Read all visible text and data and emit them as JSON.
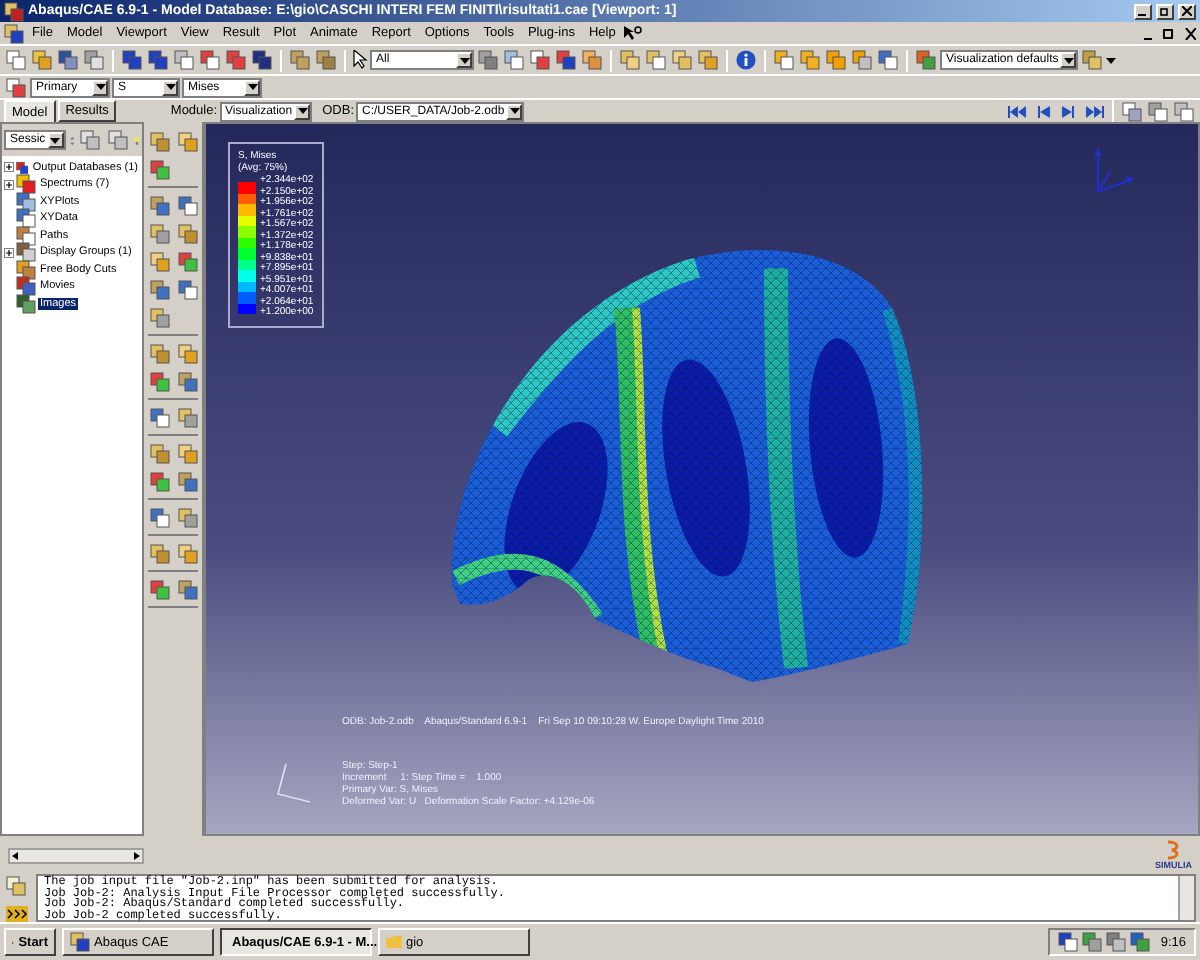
{
  "window": {
    "title": "Abaqus/CAE 6.9-1 - Model Database: E:\\gio\\CASCHI INTERI FEM FINITI\\risultati1.cae [Viewport: 1]"
  },
  "menu": [
    "File",
    "Model",
    "Viewport",
    "View",
    "Result",
    "Plot",
    "Animate",
    "Report",
    "Options",
    "Tools",
    "Plug-ins",
    "Help"
  ],
  "toolbar": {
    "selection_filter": "All",
    "view_defaults": "Visualization defaults"
  },
  "field_output": {
    "step": "Primary",
    "variable": "S",
    "invariant": "Mises"
  },
  "tabs": [
    {
      "label": "Model",
      "selected": true
    },
    {
      "label": "Results",
      "selected": false
    }
  ],
  "context": {
    "module_label": "Module:",
    "module": "Visualization",
    "odb_label": "ODB:",
    "odb": "C:/USER_DATA/Job-2.odb"
  },
  "tree": {
    "filter": "Sessic",
    "items": [
      {
        "label": "Output Databases (1)",
        "collapsible": true,
        "selected": false
      },
      {
        "label": "Spectrums (7)",
        "collapsible": true,
        "selected": false
      },
      {
        "label": "XYPlots",
        "collapsible": false,
        "selected": false
      },
      {
        "label": "XYData",
        "collapsible": false,
        "selected": false
      },
      {
        "label": "Paths",
        "collapsible": false,
        "selected": false
      },
      {
        "label": "Display Groups (1)",
        "collapsible": true,
        "selected": false
      },
      {
        "label": "Free Body Cuts",
        "collapsible": false,
        "selected": false
      },
      {
        "label": "Movies",
        "collapsible": false,
        "selected": false
      },
      {
        "label": "Images",
        "collapsible": false,
        "selected": true
      }
    ]
  },
  "viewport": {
    "legend": {
      "title": "S, Mises",
      "subtitle": "(Avg: 75%)",
      "bands": [
        {
          "color": "#ff0000"
        },
        {
          "color": "#ff5d00"
        },
        {
          "color": "#ffb900"
        },
        {
          "color": "#e6ff00"
        },
        {
          "color": "#8aff00"
        },
        {
          "color": "#2eff00"
        },
        {
          "color": "#00ff2e"
        },
        {
          "color": "#00ff8a"
        },
        {
          "color": "#00ffe6"
        },
        {
          "color": "#00b9ff"
        },
        {
          "color": "#005dff"
        },
        {
          "color": "#0000ff"
        }
      ],
      "labels": [
        "+2.344e+02",
        "+2.150e+02",
        "+1.956e+02",
        "+1.761e+02",
        "+1.567e+02",
        "+1.372e+02",
        "+1.178e+02",
        "+9.838e+01",
        "+7.895e+01",
        "+5.951e+01",
        "+4.007e+01",
        "+2.064e+01",
        "+1.200e+00"
      ]
    },
    "info": "ODB: Job-2.odb    Abaqus/Standard 6.9-1    Fri Sep 10 09:10:28 W. Europe Daylight Time 2010",
    "state": [
      "Step: Step-1",
      "Increment     1: Step Time =    1.000",
      "Primary Var: S, Mises",
      "Deformed Var: U   Deformation Scale Factor: +4.129e-06"
    ]
  },
  "logo": "SIMULIA",
  "messages": [
    "The job input file \"Job-2.inp\" has been submitted for analysis.",
    "Job Job-2: Analysis Input File Processor completed successfully.",
    "Job Job-2: Abaqus/Standard completed successfully.",
    "Job Job-2 completed successfully."
  ],
  "taskbar": {
    "start": "Start",
    "tasks": [
      {
        "label": "Abaqus CAE",
        "selected": false
      },
      {
        "label": "Abaqus/CAE 6.9-1 - M...",
        "selected": true
      },
      {
        "label": "gio",
        "selected": false
      }
    ],
    "clock": "9:16"
  }
}
